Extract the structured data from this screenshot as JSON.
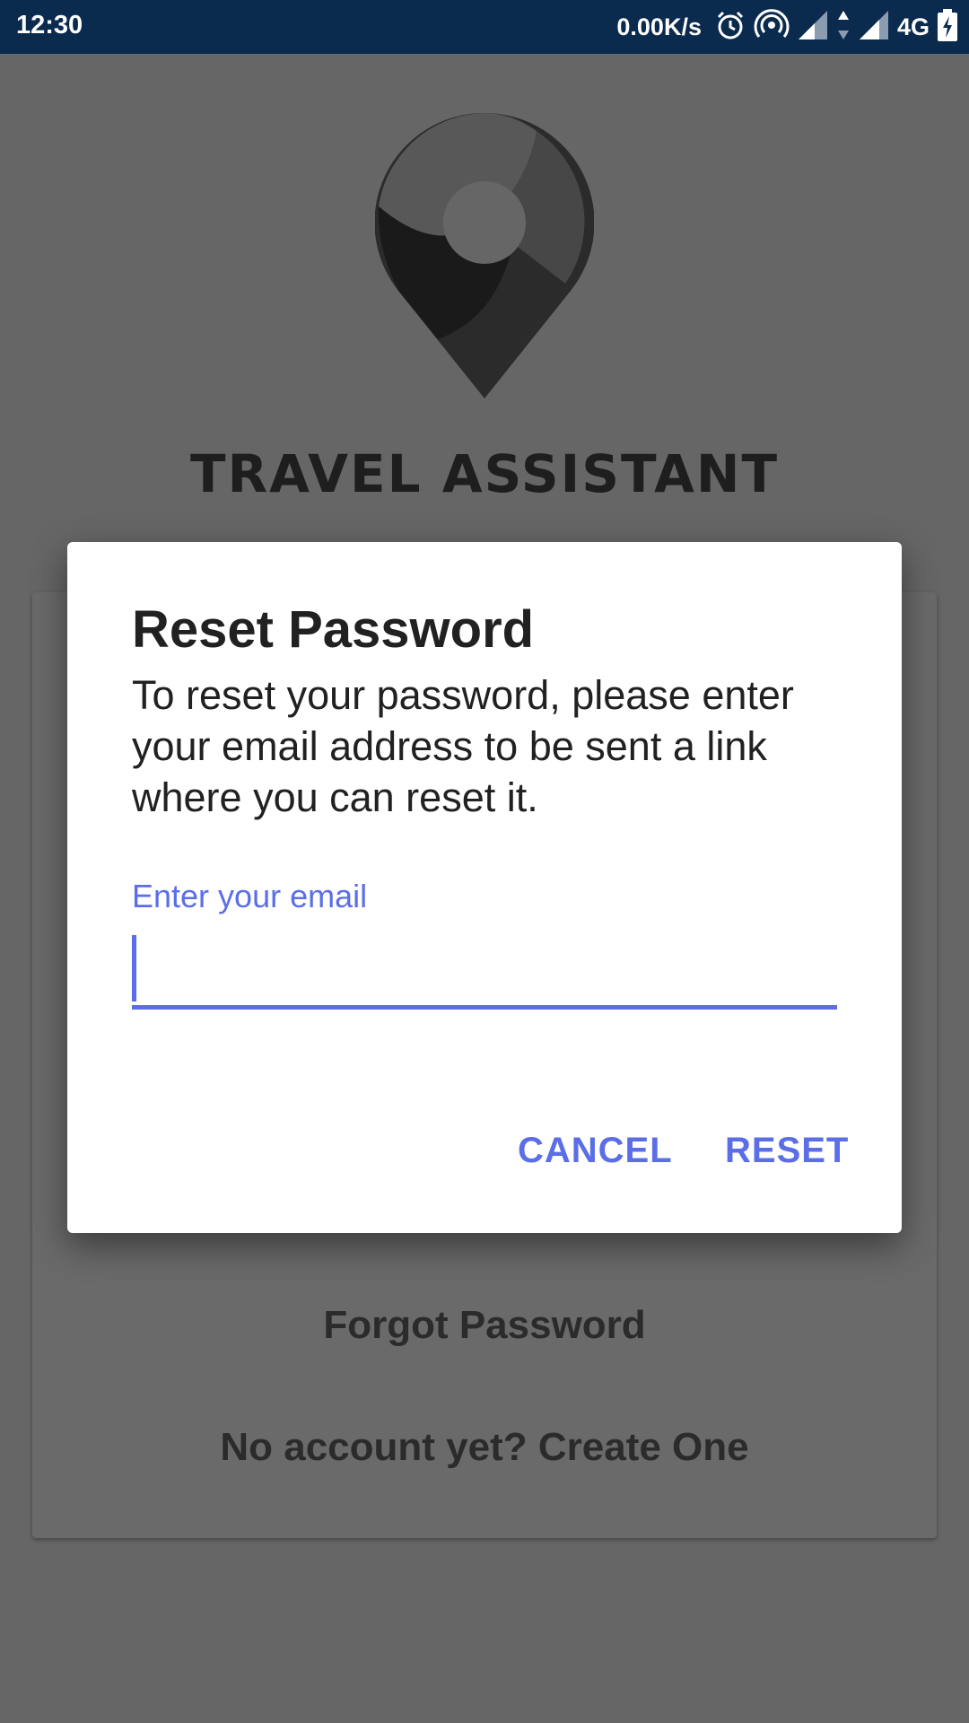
{
  "status_bar": {
    "time": "12:30",
    "net_speed": "0.00K/s",
    "network_type": "4G",
    "icons": [
      "alarm-icon",
      "hotspot-icon",
      "signal-icon",
      "data-arrows-icon",
      "signal-icon",
      "battery-charging-icon"
    ]
  },
  "app": {
    "title": "TRAVEL ASSISTANT",
    "logo_icon": "map-pin-logo"
  },
  "background_card": {
    "forgot_password": "Forgot Password",
    "create_account": "No account yet? Create One"
  },
  "dialog": {
    "title": "Reset Password",
    "message": "To reset your password, please enter your email address to be sent a link where you can reset it.",
    "email_label": "Enter your email",
    "email_value": "",
    "cancel_label": "CANCEL",
    "reset_label": "RESET"
  },
  "colors": {
    "accent": "#5b6ee8",
    "status_bar": "#0a2a4e",
    "scrim": "#666666"
  }
}
